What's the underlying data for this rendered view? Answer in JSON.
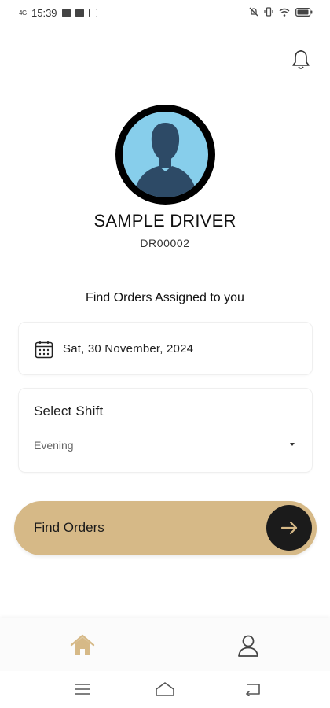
{
  "status_bar": {
    "network": "4G",
    "time": "15:39",
    "notification_icons": [
      "s-icon",
      "youtube-icon",
      "mail-icon"
    ],
    "system_icons": [
      "mute-icon",
      "vibrate-icon",
      "wifi-icon",
      "battery-icon"
    ]
  },
  "header": {
    "notification_icon": "bell-icon"
  },
  "profile": {
    "name": "SAMPLE DRIVER",
    "id": "DR00002",
    "avatar_bg": "#87ceeb"
  },
  "find_section": {
    "title": "Find Orders Assigned to you",
    "date_value": "Sat, 30 November, 2024",
    "shift_label": "Select Shift",
    "shift_value": "Evening"
  },
  "find_button": {
    "label": "Find Orders",
    "color": "#d6b987",
    "arrow_bg": "#1b1b1b"
  },
  "bottom_nav": {
    "items": [
      {
        "icon": "home-icon",
        "active": true,
        "color": "#d6b987"
      },
      {
        "icon": "profile-icon",
        "active": false
      }
    ]
  },
  "system_nav": [
    "menu-icon",
    "home-icon",
    "back-icon"
  ]
}
